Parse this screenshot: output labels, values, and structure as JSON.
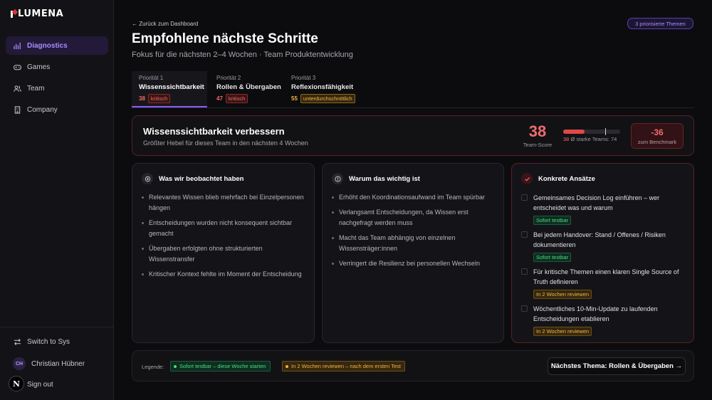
{
  "app": {
    "logo_text": "LUMENA"
  },
  "sidebar": {
    "items": [
      {
        "label": "Diagnostics",
        "icon": "chart-icon",
        "active": true
      },
      {
        "label": "Games",
        "icon": "gamepad-icon"
      },
      {
        "label": "Team",
        "icon": "users-icon"
      },
      {
        "label": "Company",
        "icon": "building-icon"
      }
    ],
    "switch_label": "Switch to Sys",
    "user": {
      "initials": "CH",
      "name": "Christian Hübner"
    },
    "signout_label": "Sign out",
    "n_badge": "N"
  },
  "header": {
    "back_label": "← Zurück zum Dashboard",
    "title": "Empfohlene nächste Schritte",
    "subtitle": "Fokus für die nächsten 2–4 Wochen · Team Produktentwicklung",
    "badge": "3 priorisierte Themen"
  },
  "tabs": [
    {
      "kicker": "Priorität 1",
      "title": "Wissenssichtbarkeit",
      "score": "38",
      "status": "kritisch"
    },
    {
      "kicker": "Priorität 2",
      "title": "Rollen & Übergaben",
      "score": "47",
      "status": "kritisch"
    },
    {
      "kicker": "Priorität 3",
      "title": "Reflexionsfähigkeit",
      "score": "55",
      "status": "unterdurchschnittlich"
    }
  ],
  "focus": {
    "title": "Wissenssichtbarkeit verbessern",
    "subtitle": "Größter Hebel für dieses Team in den nächsten 4 Wochen",
    "score": "38",
    "score_label": "Team-Score",
    "score_fraction": 0.38,
    "benchmark_fraction": 0.74,
    "bar_score": "38",
    "bar_caption": "Ø starke Teams: 74",
    "delta": "-36",
    "delta_label": "zum Benchmark"
  },
  "observed": {
    "title": "Was wir beobachtet haben",
    "items": [
      "Relevantes Wissen blieb mehrfach bei Einzelpersonen hängen",
      "Entscheidungen wurden nicht konsequent sichtbar gemacht",
      "Übergaben erfolgten ohne strukturierten Wissenstransfer",
      "Kritischer Kontext fehlte im Moment der Entscheidung"
    ]
  },
  "why": {
    "title": "Warum das wichtig ist",
    "items": [
      "Erhöht den Koordinationsaufwand im Team spürbar",
      "Verlangsamt Entscheidungen, da Wissen erst nachgefragt werden muss",
      "Macht das Team abhängig von einzelnen Wissensträger:innen",
      "Verringert die Resilienz bei personellen Wechseln"
    ]
  },
  "actions": {
    "title": "Konkrete Ansätze",
    "items": [
      {
        "text": "Gemeinsames Decision Log einführen – wer entscheidet was und warum",
        "tag": "Sofort testbar",
        "tag_type": "green"
      },
      {
        "text": "Bei jedem Handover: Stand / Offenes / Risiken dokumentieren",
        "tag": "Sofort testbar",
        "tag_type": "green"
      },
      {
        "text": "Für kritische Themen einen klaren Single Source of Truth definieren",
        "tag": "In 2 Wochen reviewen",
        "tag_type": "amber"
      },
      {
        "text": "Wöchentliches 10-Min-Update zu laufenden Entscheidungen etablieren",
        "tag": "In 2 Wochen reviewen",
        "tag_type": "amber"
      }
    ]
  },
  "footer": {
    "legend_label": "Legende:",
    "legend_green": "Sofort testbar – diese Woche starten",
    "legend_amber": "In 2 Wochen reviewen – nach dem ersten Test",
    "next_label": "Nächstes Thema: Rollen & Übergaben →"
  },
  "colors": {
    "accent": "#8b5cf6",
    "critical": "#f06b6b",
    "warning": "#f5b23f",
    "success": "#4ade80"
  }
}
